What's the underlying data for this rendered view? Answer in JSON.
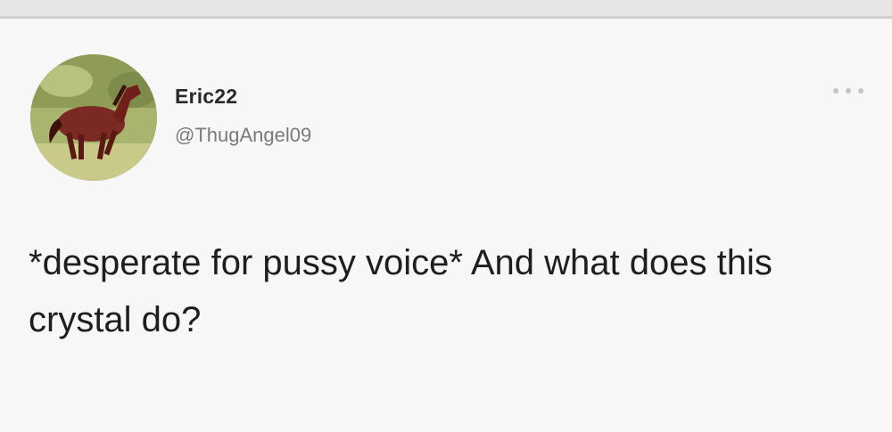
{
  "tweet": {
    "display_name": "Eric22",
    "handle": "@ThugAngel09",
    "text": "*desperate for pussy voice* And what does this crystal do?"
  },
  "icons": {
    "avatar": "horse-avatar-icon",
    "more": "more-options-icon"
  },
  "colors": {
    "card_background": "#f7f7f7",
    "text": "#1e1e1e",
    "handle": "#7a7a7a"
  }
}
